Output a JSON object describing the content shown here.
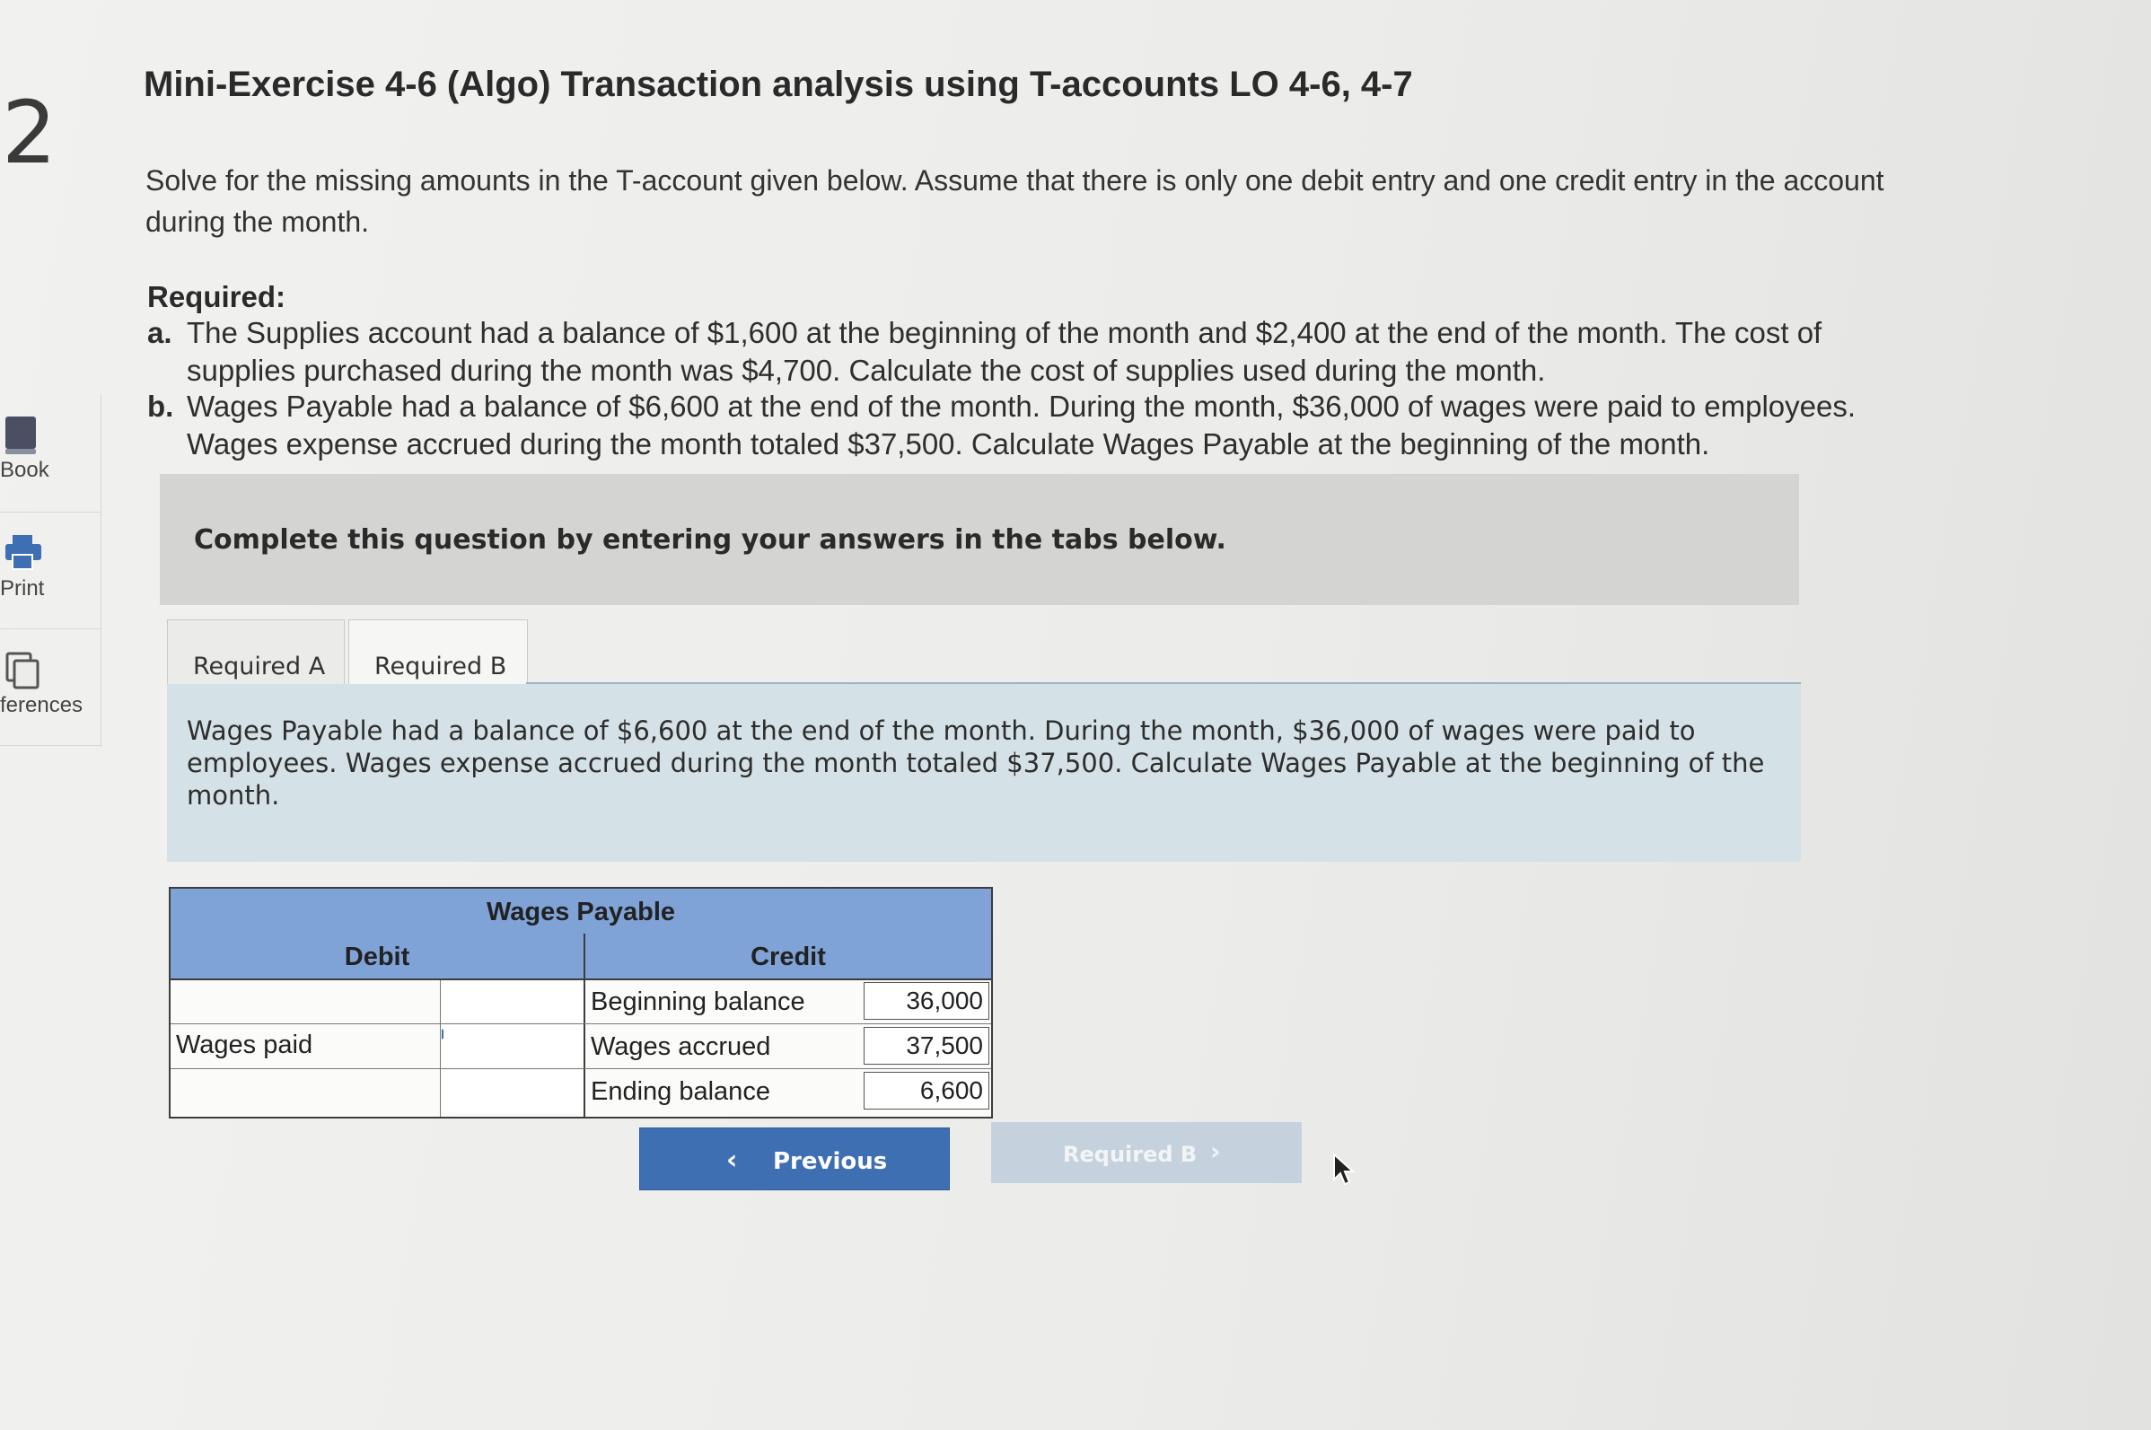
{
  "question_number": "2",
  "sidebar": {
    "book_label": "Book",
    "print_label": "Print",
    "references_label": "ferences"
  },
  "header": {
    "title": "Mini-Exercise 4-6 (Algo) Transaction analysis using T-accounts LO 4-6, 4-7"
  },
  "intro": "Solve for the missing amounts in the T-account given below. Assume that there is only one debit entry and one credit entry in the account during the month.",
  "required": {
    "heading": "Required:",
    "items": [
      {
        "letter": "a.",
        "text": "The Supplies account had a balance of $1,600 at the beginning of the month and $2,400 at the end of the month. The cost of supplies purchased during the month was $4,700. Calculate the cost of supplies used during the month."
      },
      {
        "letter": "b.",
        "text": "Wages Payable had a balance of $6,600 at the end of the month. During the month, $36,000 of wages were paid to employees. Wages expense accrued during the month totaled $37,500. Calculate Wages Payable at the beginning of the month."
      }
    ]
  },
  "banner": "Complete this question by entering your answers in the tabs below.",
  "tabs": [
    {
      "label": "Required A",
      "active": false
    },
    {
      "label": "Required B",
      "active": true
    }
  ],
  "panel_text": "Wages Payable had a balance of $6,600 at the end of the month. During the month, $36,000 of wages were paid to employees. Wages expense accrued during the month totaled $37,500. Calculate Wages Payable at the beginning of the month.",
  "t_account": {
    "title": "Wages Payable",
    "debit_header": "Debit",
    "credit_header": "Credit",
    "debit_rows": [
      {
        "label": "",
        "value": ""
      },
      {
        "label": "Wages paid",
        "value": ""
      },
      {
        "label": "",
        "value": ""
      }
    ],
    "credit_rows": [
      {
        "label": "Beginning balance",
        "value": "36,000"
      },
      {
        "label": "Wages accrued",
        "value": "37,500"
      },
      {
        "label": "Ending balance",
        "value": "6,600"
      }
    ],
    "header_color": "#7fa3d6"
  },
  "nav": {
    "previous_label": "Previous",
    "next_label": "Required B",
    "previous_color": "#3f6fb3",
    "next_color": "#c5d2dd"
  }
}
